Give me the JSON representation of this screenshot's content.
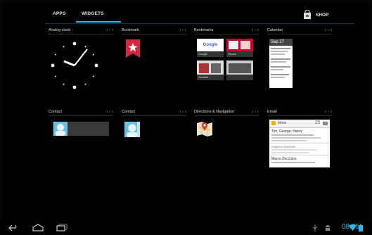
{
  "tabs": [
    {
      "label": "APPS",
      "active": false
    },
    {
      "label": "WIDGETS",
      "active": true
    }
  ],
  "shop": {
    "label": "SHOP",
    "icon": "shop-bag-icon"
  },
  "widgets": [
    {
      "title": "Analog clock",
      "size": "2 × 2"
    },
    {
      "title": "Bookmark",
      "size": "1 × 1"
    },
    {
      "title": "Bookmarks",
      "size": "3 × 3"
    },
    {
      "title": "Calendar",
      "size": "2 × 3"
    },
    {
      "title": "Contact",
      "size": "3 × 1"
    },
    {
      "title": "Contact",
      "size": "1 × 1"
    },
    {
      "title": "Directions & Navigation",
      "size": "1 × 1"
    },
    {
      "title": "Email",
      "size": "3 × 2"
    }
  ],
  "calendar_preview": {
    "date": "Sep 27"
  },
  "email_preview": {
    "account": "Inbox",
    "count": "15",
    "rows": [
      {
        "sender": "Tim, George, Henry"
      },
      {
        "sender": "Angelina Santhowe"
      },
      {
        "sender": "Marco Zecchino"
      }
    ]
  },
  "bookmarks_preview": {
    "labels": [
      "Google",
      "Picasa",
      "Youtube"
    ]
  },
  "status": {
    "time": "08:05"
  },
  "colors": {
    "accent": "#33b5e5",
    "bookmark_red": "#d7263d"
  }
}
